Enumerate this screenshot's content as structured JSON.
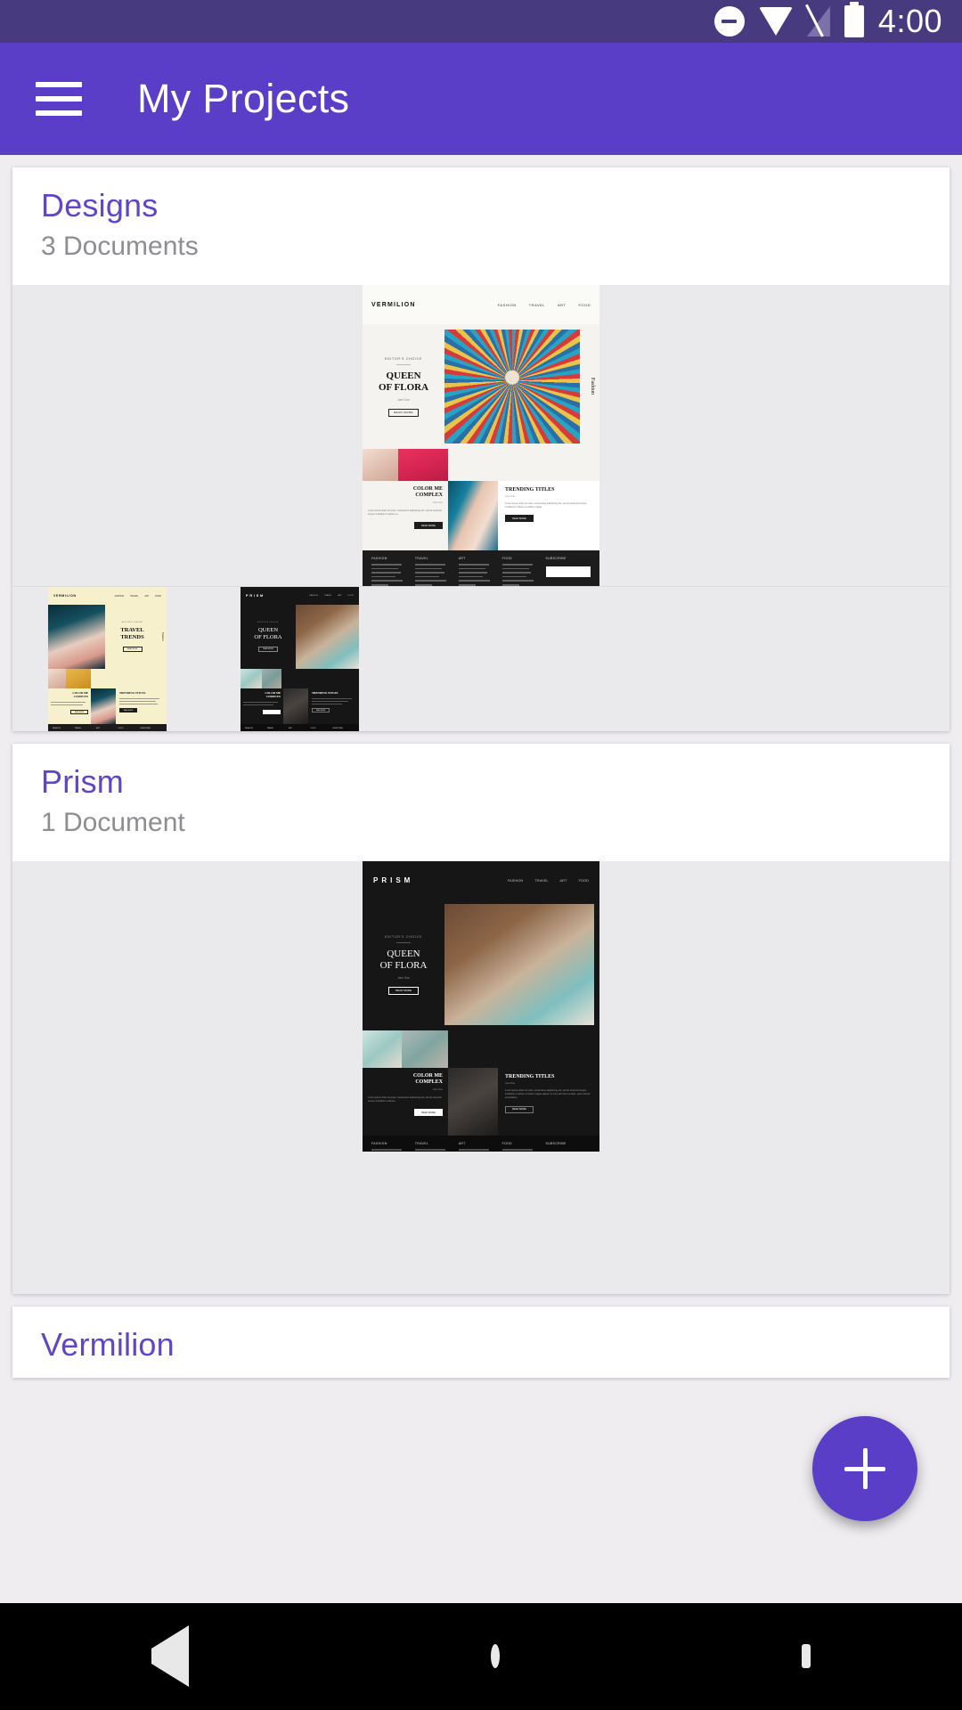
{
  "status_bar": {
    "time": "4:00",
    "icons": [
      "do-not-disturb-icon",
      "wifi-icon",
      "cellular-off-icon",
      "battery-icon"
    ],
    "background_color": "#473a7e"
  },
  "app_bar": {
    "menu_icon": "hamburger-menu-icon",
    "title": "My Projects",
    "background_color": "#5b3ec8",
    "text_color": "#ffffff"
  },
  "theme": {
    "accent": "#5b3ec8",
    "card_title_color": "#5e46c4",
    "card_subtitle_color": "#8d8d92",
    "page_background": "#efedf0",
    "thumb_background": "#eaeaec"
  },
  "projects": [
    {
      "name": "Designs",
      "document_count": "3 Documents",
      "documents": [
        {
          "id": "vermilion-white",
          "brand": "VERMILION",
          "nav": [
            "FASHION",
            "TRAVEL",
            "ART",
            "FOOD"
          ],
          "eyebrow": "EDITOR'S CHOICE",
          "headline_line1": "QUEEN",
          "headline_line2": "OF FLORA",
          "byline": "Jane Doe",
          "cta": "READ MORE",
          "side_label": "Fashion",
          "section2_line1": "COLOR ME",
          "section2_line2": "COMPLEX",
          "section2_byline": "Jane Doe",
          "section2_body": "Lorem ipsum dolor sit amet, consectetur adipisicing elit, sed do eiusmod tempor incididunt ut labore et.",
          "section2_cta": "READ MORE",
          "section3_title": "TRENDING TITLES",
          "section3_byline": "Jane Doe",
          "section3_body": "Lorem ipsum dolor sit amet, consectetur adipisicing elit, sed do eiusmod tempor incididunt ut labore et dolore magna.",
          "section3_cta": "READ MORE",
          "footer_columns": [
            "FASHION",
            "TRAVEL",
            "ART",
            "FOOD"
          ],
          "footer_links": [
            "Lorem ipsum",
            "dolor sit amet",
            "consectetur",
            "adipisicing elit",
            "sed do eiusmod",
            "tempor"
          ],
          "subscribe_label": "SUBSCRIBE",
          "theme": "light"
        },
        {
          "id": "vermilion-cream",
          "brand": "VERMILION",
          "nav": [
            "FASHION",
            "TRAVEL",
            "ART",
            "FOOD"
          ],
          "eyebrow": "EDITOR'S CHOICE",
          "headline_line1": "TRAVEL",
          "headline_line2": "TRENDS",
          "cta": "READ MORE",
          "side_label": "Fashion",
          "section2_line1": "COLOR ME",
          "section2_line2": "COMPLEX",
          "section2_cta": "READ MORE",
          "section3_title": "TRENDING TITLES",
          "section3_cta": "READ MORE",
          "footer_columns": [
            "FASHION",
            "TRAVEL",
            "ART",
            "FOOD"
          ],
          "subscribe_label": "SUBSCRIBE",
          "theme": "cream"
        },
        {
          "id": "prism-dark-small",
          "brand": "PRISM",
          "nav": [
            "FASHION",
            "TRAVEL",
            "ART",
            "FOOD"
          ],
          "eyebrow": "EDITOR'S CHOICE",
          "headline_line1": "QUEEN",
          "headline_line2": "OF FLORA",
          "cta": "READ MORE",
          "section2_line1": "COLOR ME",
          "section2_line2": "COMPLEX",
          "section3_title": "TRENDING TITLES",
          "section3_cta": "READ MORE",
          "footer_columns": [
            "FASHION",
            "TRAVEL",
            "ART",
            "FOOD"
          ],
          "subscribe_label": "SUBSCRIBE",
          "theme": "dark"
        }
      ]
    },
    {
      "name": "Prism",
      "document_count": "1 Document",
      "documents": [
        {
          "id": "prism-dark",
          "brand": "PRISM",
          "nav": [
            "FASHION",
            "TRAVEL",
            "ART",
            "FOOD"
          ],
          "eyebrow": "EDITOR'S CHOICE",
          "headline_line1": "QUEEN",
          "headline_line2": "OF FLORA",
          "byline": "Jane Doe",
          "cta": "READ MORE",
          "section2_line1": "COLOR ME",
          "section2_line2": "COMPLEX",
          "section2_byline": "Jane Doe",
          "section2_body": "Lorem ipsum dolor sit amet, consectetur adipisicing elit, sed do eiusmod tempor incididunt ut labore.",
          "section2_cta": "READ MORE",
          "section3_title": "TRENDING TITLES",
          "section3_byline": "Jane Doe",
          "section3_body": "Lorem ipsum dolor sit amet, consectetur adipisicing elit, sed do eiusmod tempor incididunt ut labore et dolore magna aliqua. Ut enim ad minim veniam, quis nostrud exercitation.",
          "section3_cta": "READ MORE",
          "footer_columns": [
            "FASHION",
            "TRAVEL",
            "ART",
            "FOOD"
          ],
          "footer_links": [
            "Lorem ipsum",
            "dolor sit amet",
            "consectetur",
            "adipisicing elit",
            "sed do eiusmod",
            "tempor"
          ],
          "subscribe_label": "SUBSCRIBE",
          "theme": "dark"
        }
      ]
    },
    {
      "name": "Vermilion",
      "document_count": "",
      "documents": []
    }
  ],
  "fab": {
    "icon": "plus-icon",
    "label": "Add project",
    "color": "#5b3ec8"
  },
  "nav_bar": {
    "items": [
      {
        "icon": "back-triangle-icon",
        "label": "Back"
      },
      {
        "icon": "home-circle-icon",
        "label": "Home"
      },
      {
        "icon": "recents-square-icon",
        "label": "Recents"
      }
    ],
    "background_color": "#000000"
  }
}
